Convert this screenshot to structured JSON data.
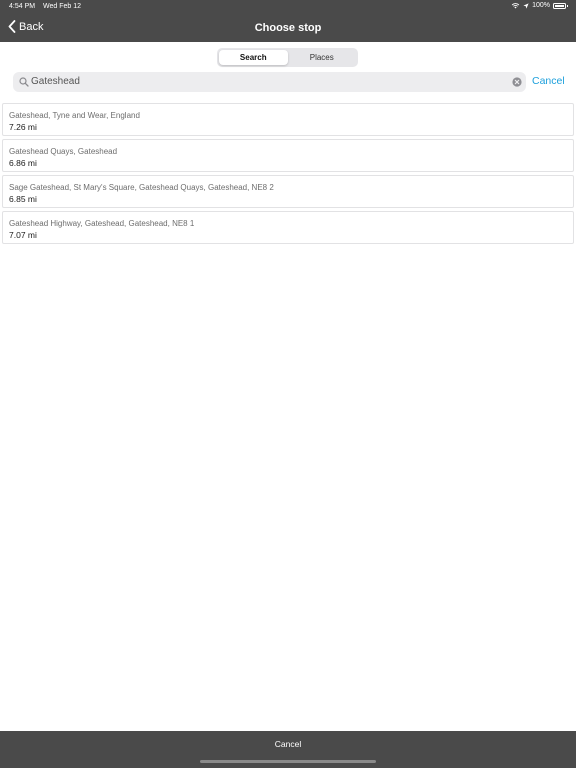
{
  "status_bar": {
    "time": "4:54 PM",
    "date": "Wed Feb 12",
    "battery_text": "100%",
    "battery_level": 1.0,
    "icons": [
      "wifi-icon",
      "location-icon",
      "battery-icon"
    ]
  },
  "nav": {
    "back_label": "Back",
    "title": "Choose stop"
  },
  "segments": [
    {
      "label": "Search",
      "selected": true
    },
    {
      "label": "Places",
      "selected": false
    }
  ],
  "search": {
    "value": "Gateshead",
    "cancel_label": "Cancel"
  },
  "results": [
    {
      "name": "Gateshead, Tyne and Wear, England",
      "distance": "7.26 mi"
    },
    {
      "name": "Gateshead Quays, Gateshead",
      "distance": "6.86 mi"
    },
    {
      "name": "Sage Gateshead, St Mary's Square, Gateshead Quays, Gateshead, NE8 2",
      "distance": "6.85 mi"
    },
    {
      "name": "Gateshead Highway, Gateshead, Gateshead, NE8 1",
      "distance": "7.07 mi"
    }
  ],
  "bottom": {
    "cancel_label": "Cancel"
  },
  "colors": {
    "chrome": "#4a4a4a",
    "accent": "#1ea0dc",
    "search_bg": "#ededef"
  }
}
